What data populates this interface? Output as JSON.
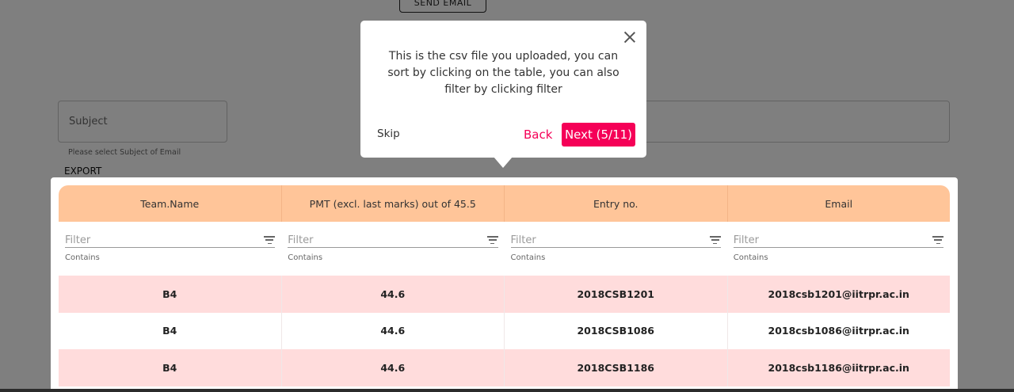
{
  "top": {
    "send_email_label": "SEND EMAIL"
  },
  "form": {
    "subject_placeholder": "Subject",
    "subject_helper": "Please select Subject of Email",
    "export_label": "EXPORT"
  },
  "table": {
    "columns": [
      "Team.Name",
      "PMT (excl. last marks) out of 45.5",
      "Entry no.",
      "Email"
    ],
    "filter_placeholder": "Filter",
    "filter_mode": "Contains",
    "rows": [
      [
        "B4",
        "44.6",
        "2018CSB1201",
        "2018csb1201@iitrpr.ac.in"
      ],
      [
        "B4",
        "44.6",
        "2018CSB1086",
        "2018csb1086@iitrpr.ac.in"
      ],
      [
        "B4",
        "44.6",
        "2018CSB1186",
        "2018csb1186@iitrpr.ac.in"
      ]
    ]
  },
  "tour": {
    "text": "This is the csv file you uploaded, you can sort by clicking on the table, you can also filter by clicking filter",
    "skip_label": "Skip",
    "back_label": "Back",
    "next_label": "Next (5/11)"
  },
  "colors": {
    "accent": "#f50057",
    "header_bg": "#ffc599",
    "row_pink": "#ffdcdc",
    "overlay": "rgba(0,0,0,0.5)"
  },
  "icons": [
    "filter-icon",
    "close-icon"
  ]
}
